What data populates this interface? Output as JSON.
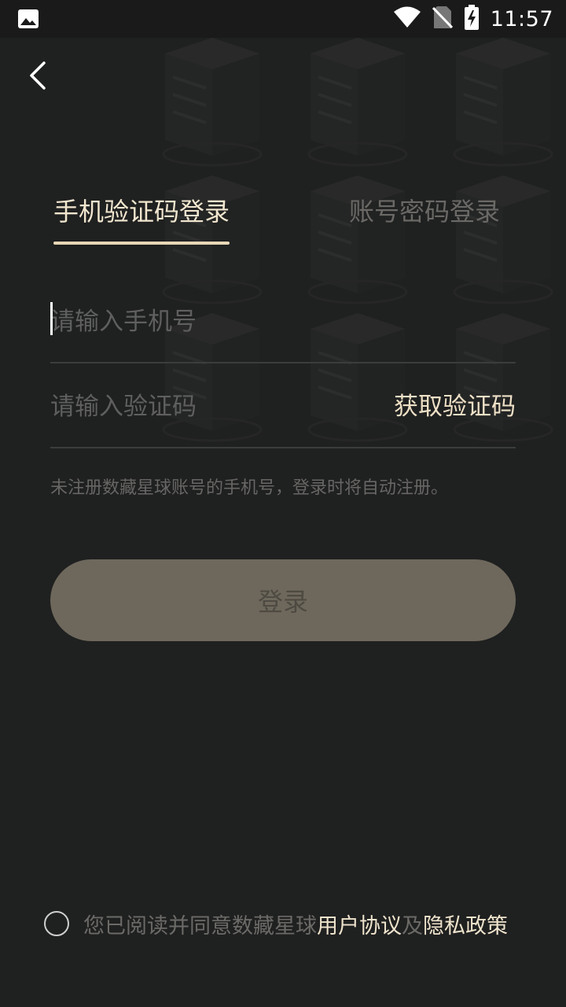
{
  "status_bar": {
    "time": "11:57",
    "icons": [
      "image-icon",
      "wifi-icon",
      "no-sim-icon",
      "battery-charging-icon"
    ]
  },
  "header": {
    "back_icon": "chevron-left-icon"
  },
  "tabs": [
    {
      "label": "手机验证码登录",
      "active": true
    },
    {
      "label": "账号密码登录",
      "active": false
    }
  ],
  "form": {
    "phone_placeholder": "请输入手机号",
    "phone_value": "",
    "code_placeholder": "请输入验证码",
    "code_value": "",
    "get_code_label": "获取验证码",
    "hint": "未注册数藏星球账号的手机号，登录时将自动注册。",
    "login_label": "登录"
  },
  "agreement": {
    "checked": false,
    "prefix": "您已阅读并同意数藏星球",
    "user_agreement": "用户协议",
    "conjunction": "及",
    "privacy_policy": "隐私政策"
  },
  "colors": {
    "background": "#1f2020",
    "accent": "#e8d7b6",
    "button_disabled": "#6e685c"
  }
}
